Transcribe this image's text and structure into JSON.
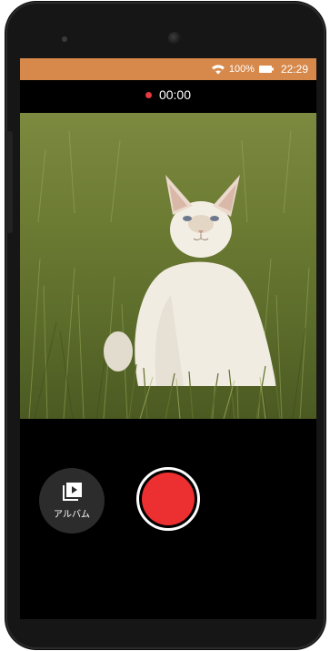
{
  "status_bar": {
    "battery_level": "100%",
    "time": "22:29",
    "color": "#d7894b",
    "wifi_icon": "wifi-icon",
    "battery_icon": "battery-icon"
  },
  "recording": {
    "timer": "00:00",
    "indicator_color": "#e8383b"
  },
  "viewfinder": {
    "subject": "cat-image"
  },
  "controls": {
    "album_label": "アルバム",
    "album_icon": "album-play-icon",
    "record_color": "#ec2f30"
  }
}
